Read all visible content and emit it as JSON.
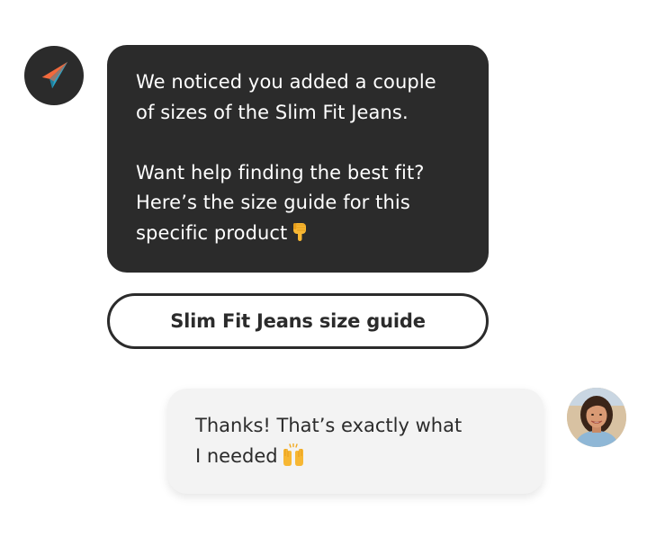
{
  "bot": {
    "avatar_icon": "paper-plane-icon",
    "message_line1": "We noticed you added a couple",
    "message_line2": "of sizes of the Slim Fit Jeans.",
    "message_line3": "Want help finding the best fit?",
    "message_line4": "Here’s the size guide for this",
    "message_line5": "specific product",
    "emoji": "point-down-icon"
  },
  "guide_button": {
    "label": "Slim Fit Jeans size guide"
  },
  "user": {
    "message_line1": "Thanks! That’s exactly what",
    "message_line2": "I needed",
    "emoji": "raised-hands-icon",
    "avatar": "user-avatar"
  },
  "colors": {
    "dark": "#2b2b2b",
    "light_bubble": "#f3f3f3",
    "plane_orange": "#f26a3d",
    "plane_teal": "#2aa6c9"
  }
}
